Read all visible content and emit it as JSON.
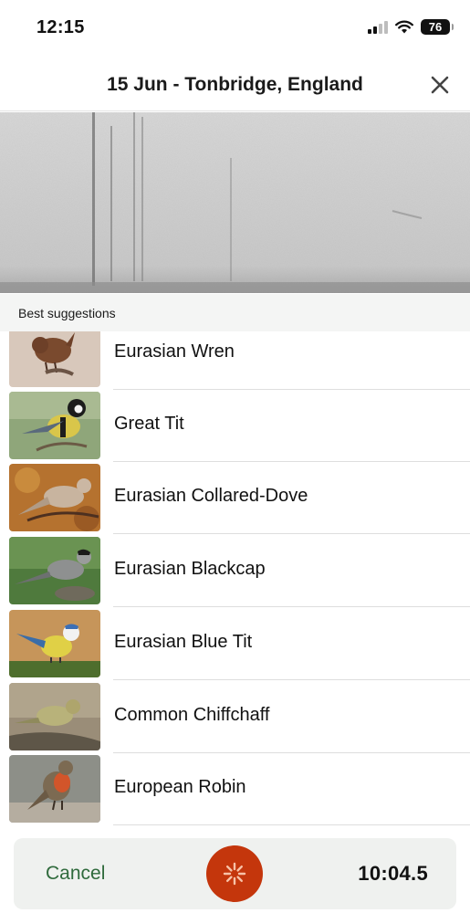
{
  "status_bar": {
    "time": "12:15",
    "battery": "76"
  },
  "header": {
    "title": "15 Jun - Tonbridge, England",
    "close_icon": "close-icon"
  },
  "section": {
    "label": "Best suggestions"
  },
  "species": [
    {
      "name": "Eurasian Wren",
      "photo": "eurasian-wren-photo"
    },
    {
      "name": "Great Tit",
      "photo": "great-tit-photo"
    },
    {
      "name": "Eurasian Collared-Dove",
      "photo": "collared-dove-photo"
    },
    {
      "name": "Eurasian Blackcap",
      "photo": "blackcap-photo"
    },
    {
      "name": "Eurasian Blue Tit",
      "photo": "blue-tit-photo"
    },
    {
      "name": "Common Chiffchaff",
      "photo": "chiffchaff-photo"
    },
    {
      "name": "European Robin",
      "photo": "robin-photo"
    }
  ],
  "bottom_bar": {
    "cancel_label": "Cancel",
    "timer": "10:04.5"
  },
  "colors": {
    "record_button": "#c4360c",
    "cancel_text": "#2f6a3c",
    "bottom_bar_bg": "#eff1ef",
    "section_bg": "#f4f5f4"
  }
}
